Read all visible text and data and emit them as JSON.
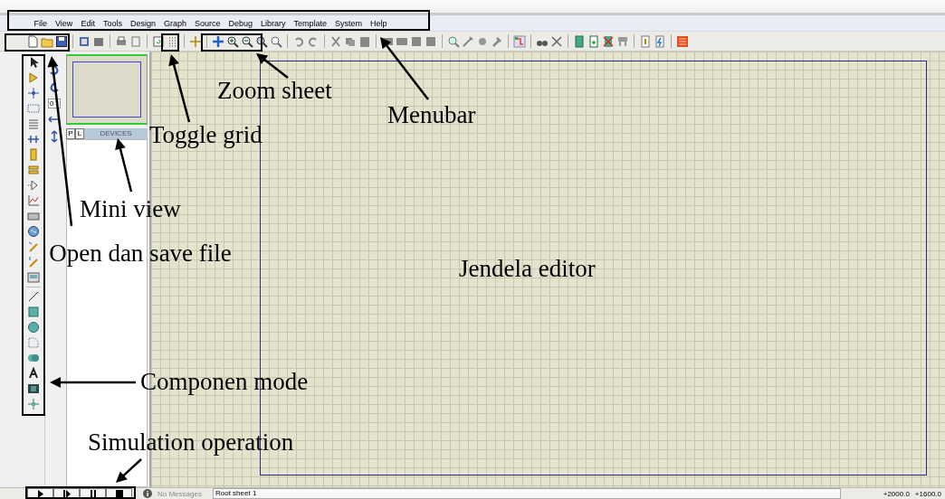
{
  "menubar": [
    "File",
    "View",
    "Edit",
    "Tools",
    "Design",
    "Graph",
    "Source",
    "Debug",
    "Library",
    "Template",
    "System",
    "Help"
  ],
  "side_panel": {
    "rotation_field": {
      "value": "0"
    },
    "tabs": [
      {
        "label": "P",
        "selected": false
      },
      {
        "label": "L",
        "selected": false
      }
    ],
    "list_header": "DEVICES"
  },
  "status_bar": {
    "messages": "No Messages",
    "sheet": "Root sheet 1",
    "x_coordinate": "+2000.0",
    "y_coordinate": "+1600.0"
  },
  "annotations": [
    {
      "text": "Zoom sheet"
    },
    {
      "text": "Toggle grid"
    },
    {
      "text": "Menubar"
    },
    {
      "text": "Mini view"
    },
    {
      "text": "Open dan save file"
    },
    {
      "text": "Jendela editor"
    },
    {
      "text": "Componen mode"
    },
    {
      "text": "Simulation operation"
    }
  ]
}
